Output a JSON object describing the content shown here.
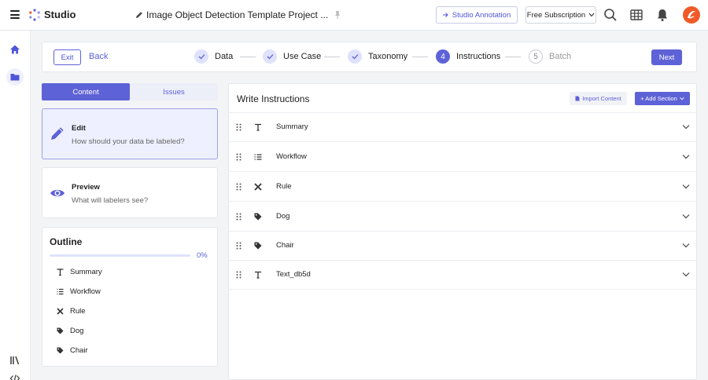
{
  "header": {
    "brand": "Studio",
    "project_title": "Image Object Detection Template Project ...",
    "studio_annotation_label": "Studio Annotation",
    "subscription_label": "Free Subscription"
  },
  "stepper": {
    "exit_label": "Exit",
    "back_label": "Back",
    "next_label": "Next",
    "steps": [
      {
        "number": "1",
        "label": "Data",
        "status": "done"
      },
      {
        "number": "2",
        "label": "Use Case",
        "status": "done"
      },
      {
        "number": "3",
        "label": "Taxonomy",
        "status": "done"
      },
      {
        "number": "4",
        "label": "Instructions",
        "status": "current"
      },
      {
        "number": "5",
        "label": "Batch",
        "status": "todo"
      }
    ]
  },
  "left_panel": {
    "tabs": [
      {
        "label": "Content",
        "active": true
      },
      {
        "label": "Issues",
        "active": false
      }
    ],
    "modes": [
      {
        "title": "Edit",
        "subtitle": "How should your data be labeled?",
        "active": true
      },
      {
        "title": "Preview",
        "subtitle": "What will labelers see?",
        "active": false
      }
    ],
    "outline": {
      "title": "Outline",
      "progress": 0,
      "progress_text": "0%",
      "items": [
        {
          "label": "Summary",
          "icon": "text-icon"
        },
        {
          "label": "Workflow",
          "icon": "list-icon"
        },
        {
          "label": "Rule",
          "icon": "rule-icon"
        },
        {
          "label": "Dog",
          "icon": "tag-icon"
        },
        {
          "label": "Chair",
          "icon": "tag-icon"
        }
      ]
    }
  },
  "right_panel": {
    "title": "Write Instructions",
    "import_label": "Import Content",
    "add_section_label": "+ Add Section",
    "sections": [
      {
        "label": "Summary",
        "icon": "text-icon"
      },
      {
        "label": "Workflow",
        "icon": "list-icon"
      },
      {
        "label": "Rule",
        "icon": "rule-icon"
      },
      {
        "label": "Dog",
        "icon": "tag-icon"
      },
      {
        "label": "Chair",
        "icon": "tag-icon"
      },
      {
        "label": "Text_db5d",
        "icon": "text-icon"
      }
    ]
  },
  "colors": {
    "accent": "#5d62d6",
    "accent_light": "#dfe2fb",
    "avatar": "#f05a28"
  }
}
